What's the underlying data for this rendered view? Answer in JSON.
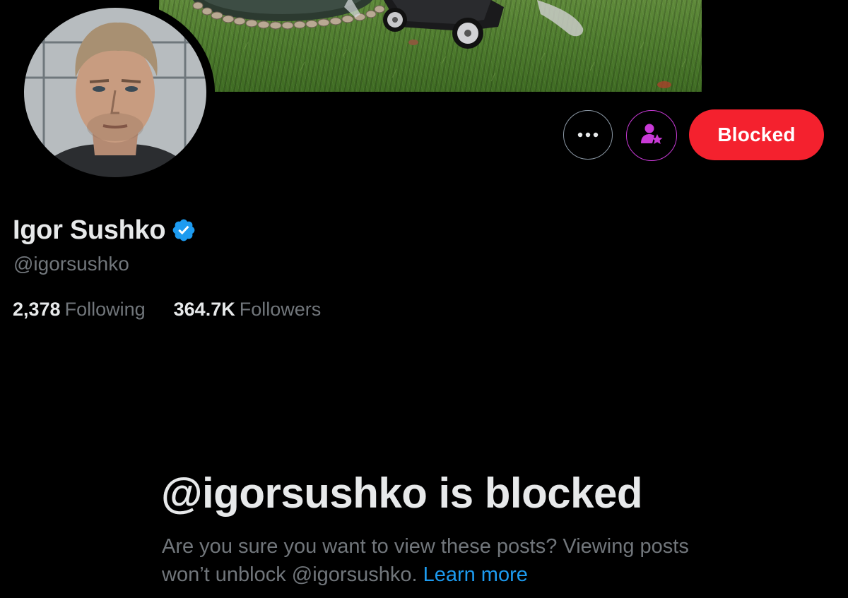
{
  "profile": {
    "display_name": "Igor Sushko",
    "handle": "@igorsushko",
    "verified": true,
    "following_count": "2,378",
    "following_label": "Following",
    "followers_count": "364.7K",
    "followers_label": "Followers"
  },
  "actions": {
    "more_icon": "more-horizontal-icon",
    "subscribe_icon": "person-star-icon",
    "blocked_label": "Blocked"
  },
  "blocked_notice": {
    "title": "@igorsushko is blocked",
    "description": "Are you sure you want to view these posts? Viewing posts won’t unblock @igorsushko.",
    "link_label": "Learn more"
  },
  "colors": {
    "background": "#000000",
    "primary_text": "#e7e9ea",
    "secondary_text": "#71767b",
    "blocked_red": "#f4212e",
    "link_blue": "#1d9bf0",
    "verified_blue": "#1d9bf0",
    "subscribe_purple": "#c93ad7"
  }
}
